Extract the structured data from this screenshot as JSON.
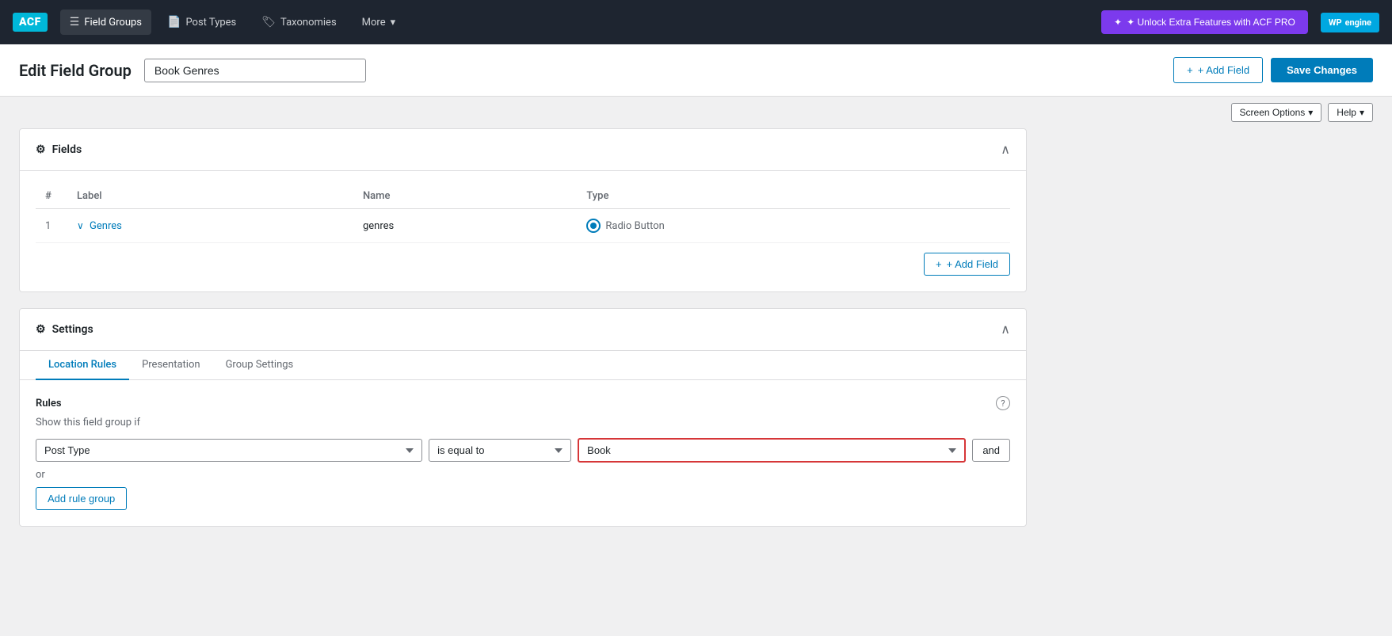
{
  "topnav": {
    "logo": "ACF",
    "items": [
      {
        "id": "field-groups",
        "label": "Field Groups",
        "icon": "☰",
        "active": true
      },
      {
        "id": "post-types",
        "label": "Post Types",
        "icon": "📄",
        "active": false
      },
      {
        "id": "taxonomies",
        "label": "Taxonomies",
        "icon": "🏷",
        "active": false
      },
      {
        "id": "more",
        "label": "More",
        "icon": "",
        "hasDropdown": true,
        "active": false
      }
    ],
    "unlock_btn": "✦ Unlock Extra Features with ACF PRO",
    "wpengine_label": "WP engine"
  },
  "header": {
    "page_title": "Edit Field Group",
    "field_group_name": "Book Genres",
    "add_field_label": "+ Add Field",
    "save_changes_label": "Save Changes"
  },
  "screen_options": {
    "label": "Screen Options",
    "dropdown_icon": "▾",
    "help_label": "Help",
    "help_dropdown_icon": "▾"
  },
  "fields_panel": {
    "title": "Fields",
    "columns": {
      "hash": "#",
      "label": "Label",
      "name": "Name",
      "type": "Type"
    },
    "rows": [
      {
        "num": "1",
        "label": "Genres",
        "name": "genres",
        "type": "Radio Button"
      }
    ],
    "add_field_label": "+ Add Field"
  },
  "settings_panel": {
    "title": "Settings",
    "tabs": [
      {
        "id": "location-rules",
        "label": "Location Rules",
        "active": true
      },
      {
        "id": "presentation",
        "label": "Presentation",
        "active": false
      },
      {
        "id": "group-settings",
        "label": "Group Settings",
        "active": false
      }
    ],
    "rules_section": {
      "title": "Rules",
      "show_if_label": "Show this field group if",
      "rule": {
        "post_type_value": "Post Type",
        "operator_value": "is equal to",
        "value_value": "Book"
      },
      "and_label": "and",
      "or_label": "or",
      "add_rule_group_label": "Add rule group"
    }
  }
}
